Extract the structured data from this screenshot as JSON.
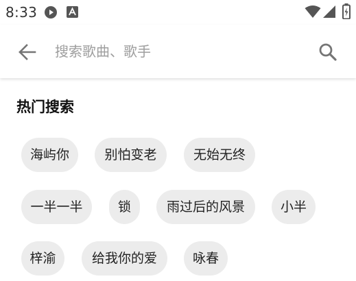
{
  "status_bar": {
    "time": "8:33",
    "left_icons": [
      "play-circle-icon",
      "font-a-icon"
    ],
    "right_icons": [
      "wifi-icon",
      "cellular-signal-icon",
      "battery-icon"
    ]
  },
  "search_bar": {
    "back_icon": "arrow-back-icon",
    "placeholder": "搜索歌曲、歌手",
    "value": "",
    "search_icon": "search-icon"
  },
  "hot_search": {
    "title": "热门搜索",
    "tags": [
      "海屿你",
      "别怕变老",
      "无始无终",
      "一半一半",
      "锁",
      "雨过后的风景",
      "小半",
      "梓渝",
      "给我你的爱",
      "咏春"
    ]
  },
  "colors": {
    "chip_bg": "#ececec",
    "icon_gray": "#757575",
    "placeholder": "#9e9e9e",
    "text": "#212121"
  }
}
